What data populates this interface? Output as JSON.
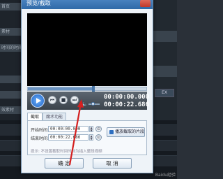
{
  "background": {
    "left_items": [
      "首页",
      "素材",
      "时间的时间",
      "",
      "",
      "效素材"
    ],
    "right_button": "EX"
  },
  "dialog": {
    "title": "预览/截取",
    "time_current": "00:00:00.000",
    "time_total": "00:00:22.686",
    "progress_fraction": 0.55,
    "volume_fraction": 0.4,
    "tabs": [
      {
        "label": "截取",
        "active": true
      },
      {
        "label": "魔术功能",
        "active": false
      }
    ],
    "start_label": "开始时间:",
    "start_value": "00:00:00.000",
    "end_label": "结束时间:",
    "end_value": "00:00:22.686",
    "play_clip_label": "播放截取的片段",
    "hint": "提示: 不设置截取时间时则为插入整段视频",
    "ok_label": "确 定",
    "cancel_label": "取 消"
  },
  "watermark": "Baidu经验",
  "colors": {
    "accent": "#2f6aa8",
    "arrow": "#d42020"
  },
  "icons": {
    "play": "play-icon",
    "prev": "skip-back-icon",
    "stop": "stop-icon",
    "next": "skip-forward-icon",
    "volume": "volume-icon",
    "pick": "pick-time-icon"
  }
}
